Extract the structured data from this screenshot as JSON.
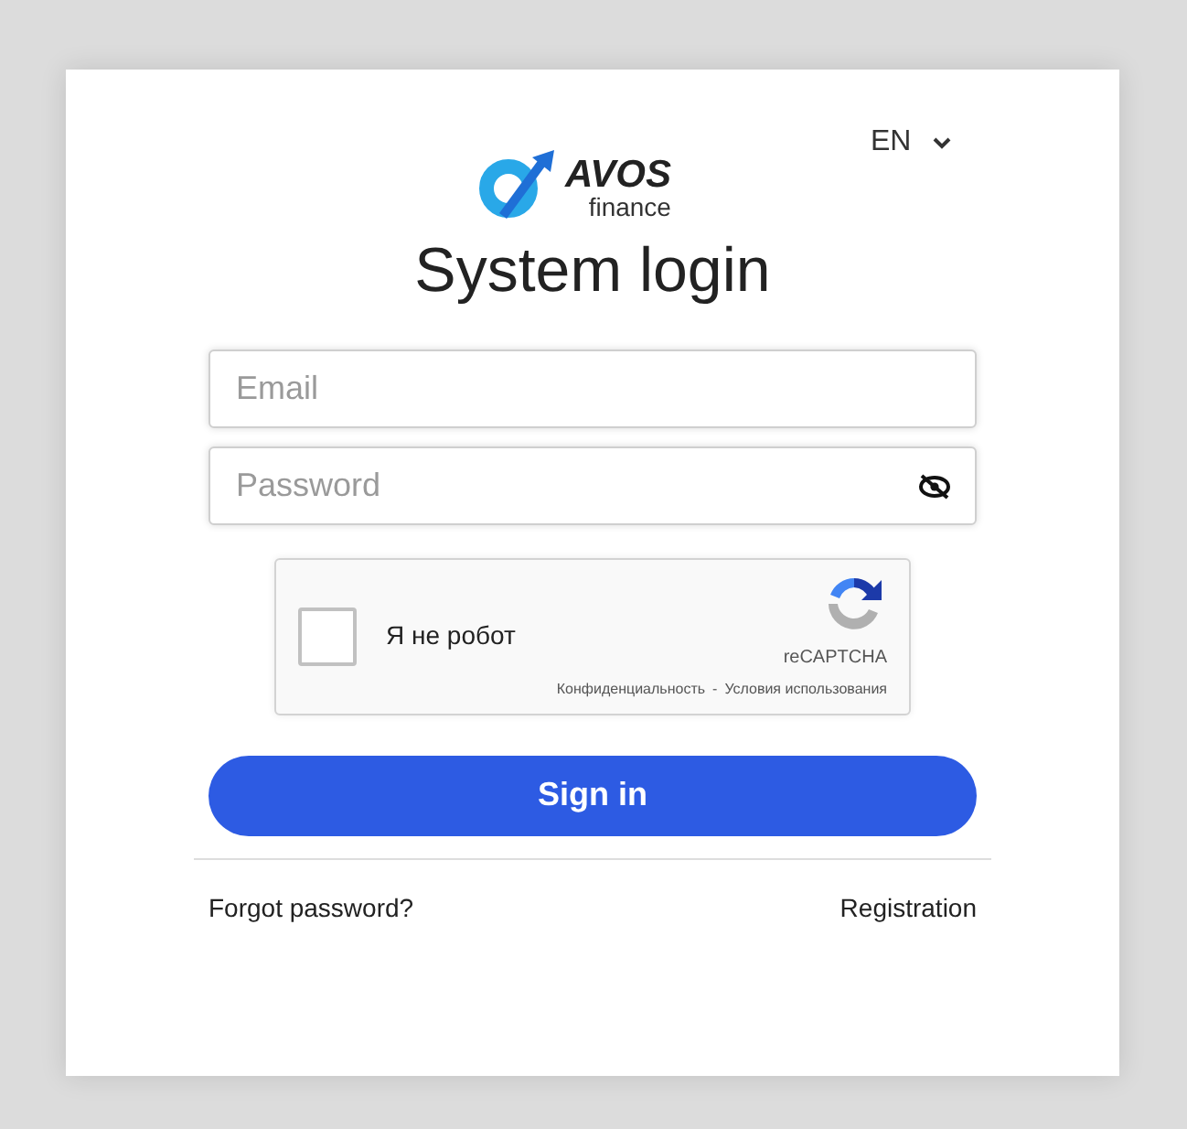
{
  "language": {
    "label": "EN"
  },
  "logo": {
    "name": "AVOS",
    "subtitle": "finance"
  },
  "title": "System login",
  "email": {
    "placeholder": "Email"
  },
  "password": {
    "placeholder": "Password",
    "visible": false
  },
  "captcha": {
    "label": "Я не робот",
    "checked": false,
    "brand": "reCAPTCHA",
    "privacy": "Конфиденциальность",
    "separator": "-",
    "terms": "Условия использования"
  },
  "submit": "Sign in",
  "links": [
    {
      "label": "Forgot password?"
    },
    {
      "label": "Registration"
    }
  ]
}
